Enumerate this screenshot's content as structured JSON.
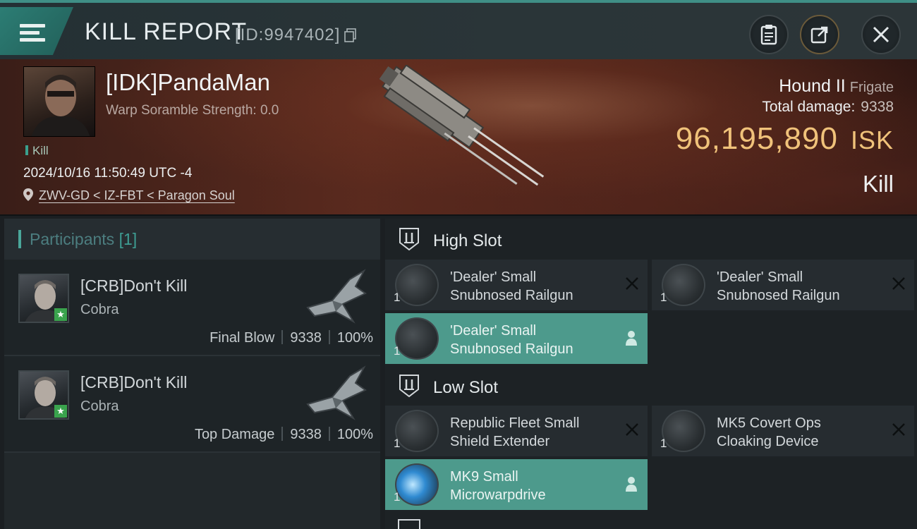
{
  "header": {
    "title": "KILL REPORT",
    "report_id": "[ID:9947402]",
    "buttons": [
      "clipboard-icon",
      "share-icon",
      "close-icon"
    ]
  },
  "victim": {
    "name": "[IDK]PandaMan",
    "warp_scramble": "Warp Soramble Strength: 0.0",
    "kill_tag": "Kill",
    "timestamp": "2024/10/16 11:50:49 UTC -4",
    "location": "ZWV-GD < IZ-FBT < Paragon Soul",
    "ship": "Hound II",
    "ship_class": "Frigate",
    "total_damage_label": "Total damage:",
    "total_damage": "9338",
    "isk_value": "96,195,890",
    "isk_unit": "ISK",
    "result": "Kill"
  },
  "participants": {
    "label": "Participants",
    "count": "[1]",
    "rows": [
      {
        "name": "[CRB]Don't Kill",
        "ship": "Cobra",
        "role": "Final Blow",
        "damage": "9338",
        "percent": "100%"
      },
      {
        "name": "[CRB]Don't Kill",
        "ship": "Cobra",
        "role": "Top Damage",
        "damage": "9338",
        "percent": "100%"
      }
    ]
  },
  "slots": {
    "high": {
      "title": "High Slot",
      "modules": [
        {
          "qty": "1",
          "name_line1": "'Dealer' Small",
          "name_line2": "Snubnosed Railgun",
          "state": "destroyed"
        },
        {
          "qty": "1",
          "name_line1": "'Dealer' Small",
          "name_line2": "Snubnosed Railgun",
          "state": "destroyed"
        },
        {
          "qty": "1",
          "name_line1": "'Dealer' Small",
          "name_line2": "Snubnosed Railgun",
          "state": "dropped"
        }
      ]
    },
    "low": {
      "title": "Low Slot",
      "modules": [
        {
          "qty": "1",
          "name_line1": "Republic Fleet Small",
          "name_line2": "Shield Extender",
          "state": "destroyed"
        },
        {
          "qty": "1",
          "name_line1": "MK5 Covert Ops",
          "name_line2": "Cloaking Device",
          "state": "destroyed"
        },
        {
          "qty": "1",
          "name_line1": "MK9 Small",
          "name_line2": "Microwarpdrive",
          "state": "dropped"
        }
      ]
    }
  },
  "colors": {
    "accent": "#4d9a8c",
    "isk": "#f0c27a",
    "star": "#3aa34d"
  }
}
